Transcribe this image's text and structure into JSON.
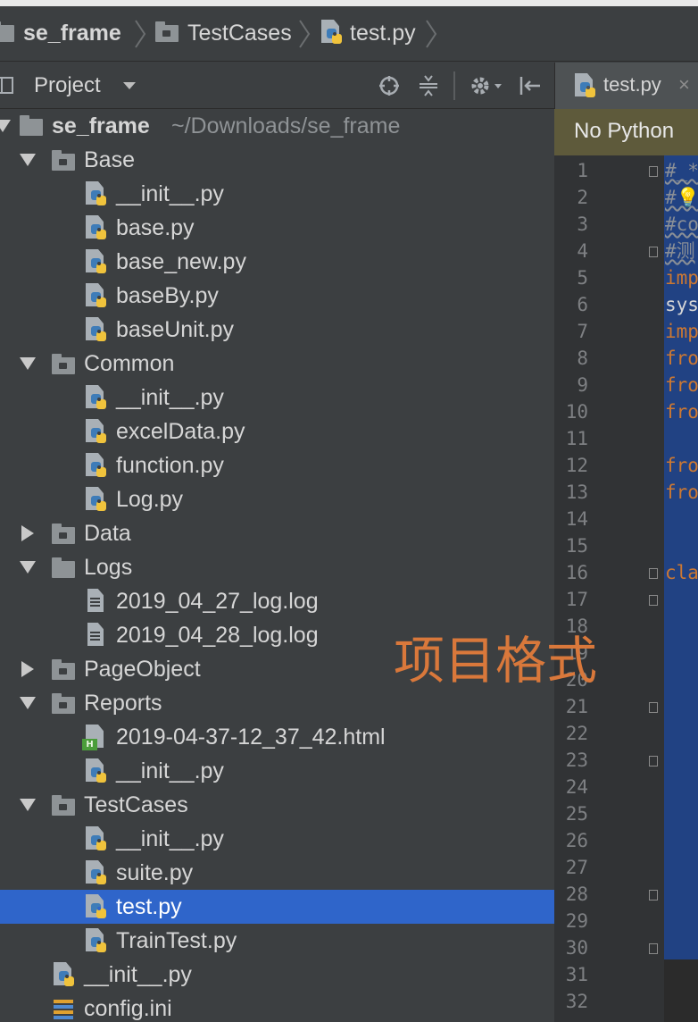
{
  "breadcrumb": {
    "items": [
      "se_frame",
      "TestCases",
      "test.py"
    ]
  },
  "project_panel": {
    "title": "Project",
    "toolbar_icons": [
      "crosshair-icon",
      "collapse-icon",
      "gear-icon",
      "hide-panel-icon"
    ]
  },
  "tree": {
    "root": {
      "name": "se_frame",
      "path": "~/Downloads/se_frame"
    },
    "rows": [
      {
        "label": "Base",
        "type": "folder",
        "state": "expanded"
      },
      {
        "label": "__init__.py",
        "type": "py"
      },
      {
        "label": "base.py",
        "type": "py"
      },
      {
        "label": "base_new.py",
        "type": "py"
      },
      {
        "label": "baseBy.py",
        "type": "py"
      },
      {
        "label": "baseUnit.py",
        "type": "py"
      },
      {
        "label": "Common",
        "type": "folder",
        "state": "expanded"
      },
      {
        "label": "__init__.py",
        "type": "py"
      },
      {
        "label": "excelData.py",
        "type": "py"
      },
      {
        "label": "function.py",
        "type": "py"
      },
      {
        "label": "Log.py",
        "type": "py"
      },
      {
        "label": "Data",
        "type": "folder",
        "state": "collapsed"
      },
      {
        "label": "Logs",
        "type": "folder",
        "state": "expanded"
      },
      {
        "label": "2019_04_27_log.log",
        "type": "log"
      },
      {
        "label": "2019_04_28_log.log",
        "type": "log"
      },
      {
        "label": "PageObject",
        "type": "folder",
        "state": "collapsed"
      },
      {
        "label": "Reports",
        "type": "folder",
        "state": "expanded"
      },
      {
        "label": "2019-04-37-12_37_42.html",
        "type": "html"
      },
      {
        "label": "__init__.py",
        "type": "py"
      },
      {
        "label": "TestCases",
        "type": "folder",
        "state": "expanded"
      },
      {
        "label": "__init__.py",
        "type": "py"
      },
      {
        "label": "suite.py",
        "type": "py"
      },
      {
        "label": "test.py",
        "type": "py",
        "selected": true
      },
      {
        "label": "TrainTest.py",
        "type": "py"
      },
      {
        "label": "__init__.py",
        "type": "py"
      },
      {
        "label": "config.ini",
        "type": "ini"
      }
    ]
  },
  "editor": {
    "tab_label": "test.py",
    "tab_close": "×",
    "banner": "No Python",
    "line_numbers": [
      "1",
      "2",
      "3",
      "4",
      "5",
      "6",
      "7",
      "8",
      "9",
      "10",
      "11",
      "12",
      "13",
      "14",
      "15",
      "16",
      "17",
      "18",
      "19",
      "20",
      "21",
      "22",
      "23",
      "24",
      "25",
      "26",
      "27",
      "28",
      "29",
      "30",
      "31",
      "32"
    ],
    "code_fragments": [
      {
        "line": 1,
        "text": "#_*",
        "kind": "comment"
      },
      {
        "line": 2,
        "text": "#💡",
        "kind": "comment"
      },
      {
        "line": 3,
        "text": "#co",
        "kind": "comment"
      },
      {
        "line": 4,
        "text": "#测",
        "kind": "comment"
      },
      {
        "line": 5,
        "text": "imp",
        "kind": "keyword"
      },
      {
        "line": 6,
        "text": "sys",
        "kind": "plain"
      },
      {
        "line": 7,
        "text": "imp",
        "kind": "keyword"
      },
      {
        "line": 8,
        "text": "fro",
        "kind": "keyword"
      },
      {
        "line": 9,
        "text": "fro",
        "kind": "keyword"
      },
      {
        "line": 10,
        "text": "fro",
        "kind": "keyword"
      },
      {
        "line": 12,
        "text": "fro",
        "kind": "keyword"
      },
      {
        "line": 13,
        "text": "fro",
        "kind": "keyword"
      },
      {
        "line": 16,
        "text": "cla",
        "kind": "keyword"
      }
    ]
  },
  "watermark": "项目格式",
  "colors": {
    "background": "#3c3f41",
    "selection": "#2f65ca",
    "keyword": "#cc7832",
    "watermark": "#d9783b",
    "code_selection": "#214283"
  }
}
